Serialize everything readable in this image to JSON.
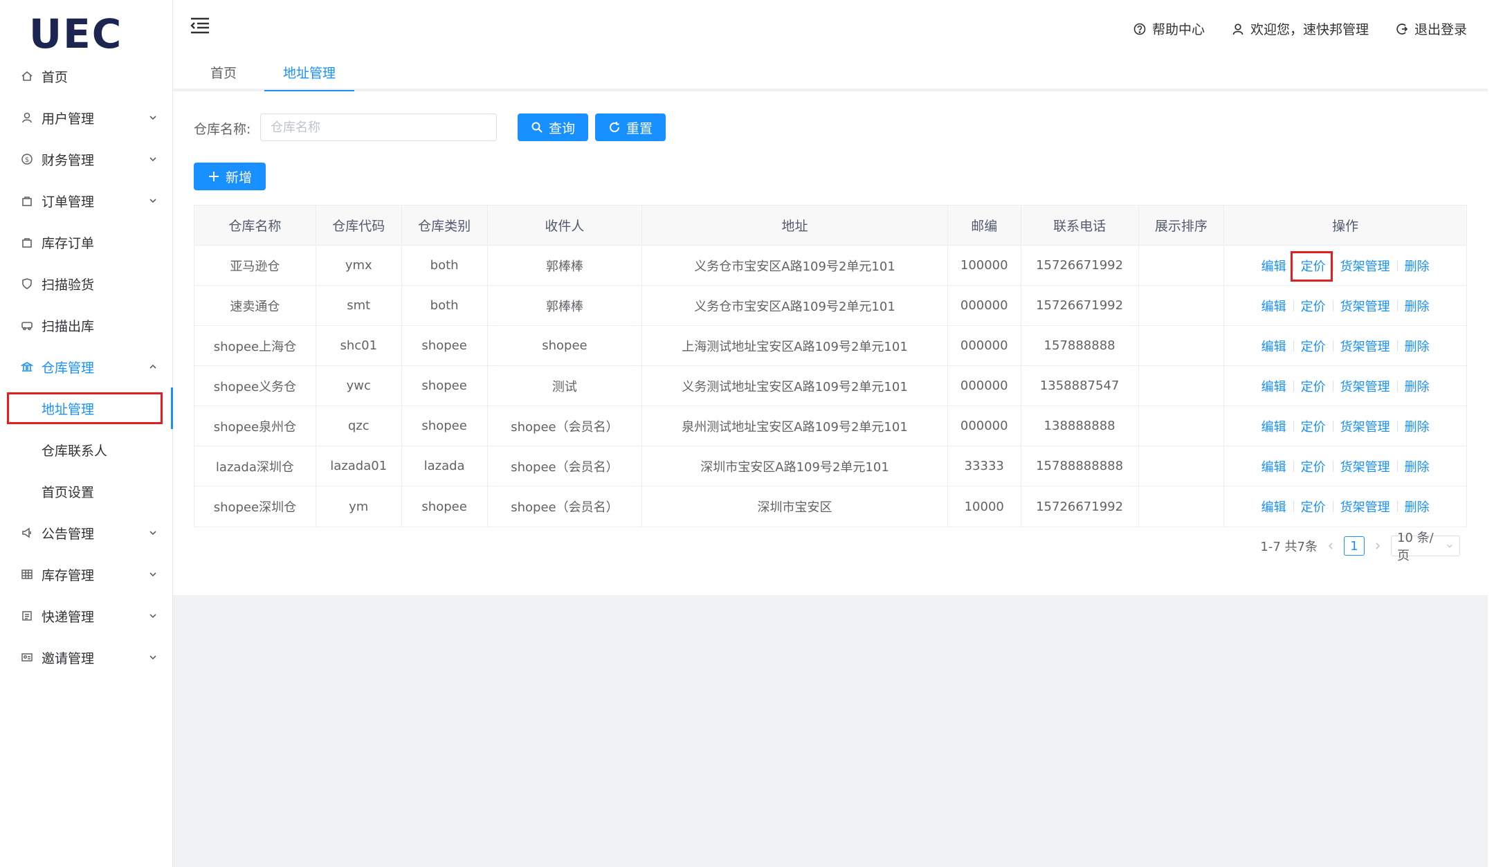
{
  "brand": {
    "logo_text": "UEC"
  },
  "header": {
    "help": "帮助中心",
    "welcome": "欢迎您，速快邦管理",
    "logout": "退出登录"
  },
  "sidebar": {
    "items": [
      {
        "label": "首页",
        "icon": "home-icon"
      },
      {
        "label": "用户管理",
        "icon": "user-icon"
      },
      {
        "label": "财务管理",
        "icon": "dollar-icon"
      },
      {
        "label": "订单管理",
        "icon": "bag-icon"
      },
      {
        "label": "库存订单",
        "icon": "bag-icon"
      },
      {
        "label": "扫描验货",
        "icon": "shield-icon"
      },
      {
        "label": "扫描出库",
        "icon": "truck-icon"
      },
      {
        "label": "仓库管理",
        "icon": "bank-icon"
      },
      {
        "label": "公告管理",
        "icon": "megaphone-icon"
      },
      {
        "label": "库存管理",
        "icon": "grid-icon"
      },
      {
        "label": "快递管理",
        "icon": "list-icon"
      },
      {
        "label": "邀请管理",
        "icon": "id-card-icon"
      }
    ],
    "sub_items": [
      "地址管理",
      "仓库联系人",
      "首页设置"
    ]
  },
  "tabs": [
    "首页",
    "地址管理"
  ],
  "search": {
    "label": "仓库名称:",
    "placeholder": "仓库名称",
    "query_button": "查询",
    "reset_button": "重置",
    "add_button": "新增"
  },
  "table": {
    "columns": [
      "仓库名称",
      "仓库代码",
      "仓库类别",
      "收件人",
      "地址",
      "邮编",
      "联系电话",
      "展示排序",
      "操作"
    ],
    "rows": [
      [
        "亚马逊仓",
        "ymx",
        "both",
        "郭棒棒",
        "义务仓市宝安区A路109号2单元101",
        "100000",
        "15726671992",
        ""
      ],
      [
        "速卖通仓",
        "smt",
        "both",
        "郭棒棒",
        "义务仓市宝安区A路109号2单元101",
        "000000",
        "15726671992",
        ""
      ],
      [
        "shopee上海仓",
        "shc01",
        "shopee",
        "shopee",
        "上海测试地址宝安区A路109号2单元101",
        "000000",
        "157888888",
        ""
      ],
      [
        "shopee义务仓",
        "ywc",
        "shopee",
        "测试",
        "义务测试地址宝安区A路109号2单元101",
        "000000",
        "1358887547",
        ""
      ],
      [
        "shopee泉州仓",
        "qzc",
        "shopee",
        "shopee（会员名）",
        "泉州测试地址宝安区A路109号2单元101",
        "000000",
        "138888888",
        ""
      ],
      [
        "lazada深圳仓",
        "lazada01",
        "lazada",
        "shopee（会员名）",
        "深圳市宝安区A路109号2单元101",
        "33333",
        "15788888888",
        ""
      ],
      [
        "shopee深圳仓",
        "ym",
        "shopee",
        "shopee（会员名）",
        "深圳市宝安区",
        "10000",
        "15726671992",
        ""
      ]
    ],
    "actions": [
      "编辑",
      "定价",
      "货架管理",
      "删除"
    ]
  },
  "pagination": {
    "summary": "1-7 共7条",
    "current_page": "1",
    "page_size": "10 条/页"
  },
  "colors": {
    "accent": "#1890ff",
    "highlight": "#e02020"
  }
}
